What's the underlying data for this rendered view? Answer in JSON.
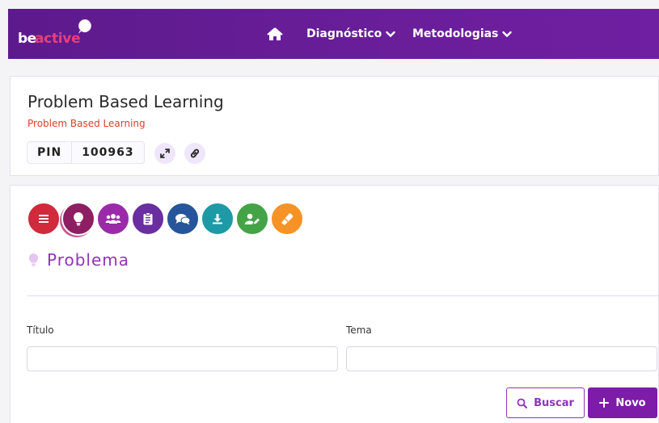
{
  "header": {
    "logo_be": "be",
    "logo_active": "active",
    "nav": [
      {
        "label": "Diagnóstico"
      },
      {
        "label": "Metodologias"
      }
    ]
  },
  "info": {
    "title": "Problem Based Learning",
    "subtitle": "Problem Based Learning",
    "pin_label": "PIN",
    "pin_value": "100963"
  },
  "tools": [
    {
      "icon": "menu-icon",
      "color": "#d02a3c"
    },
    {
      "icon": "lightbulb-icon",
      "color": "#8e1e62"
    },
    {
      "icon": "users-icon",
      "color": "#9b2aa8"
    },
    {
      "icon": "clipboard-icon",
      "color": "#6a2ea0"
    },
    {
      "icon": "comments-icon",
      "color": "#27559b"
    },
    {
      "icon": "download-icon",
      "color": "#1d9aa5"
    },
    {
      "icon": "user-edit-icon",
      "color": "#43a346"
    },
    {
      "icon": "eraser-icon",
      "color": "#f59326"
    }
  ],
  "section": {
    "title": "Problema"
  },
  "form": {
    "titulo_label": "Título",
    "titulo_value": "",
    "tema_label": "Tema",
    "tema_value": "",
    "buscar_label": "Buscar",
    "novo_label": "Novo"
  },
  "colors": {
    "header": "#6a1e9a",
    "accent": "#8e35b8",
    "primary_button": "#7d1ca8",
    "subtitle": "#d8402c"
  }
}
